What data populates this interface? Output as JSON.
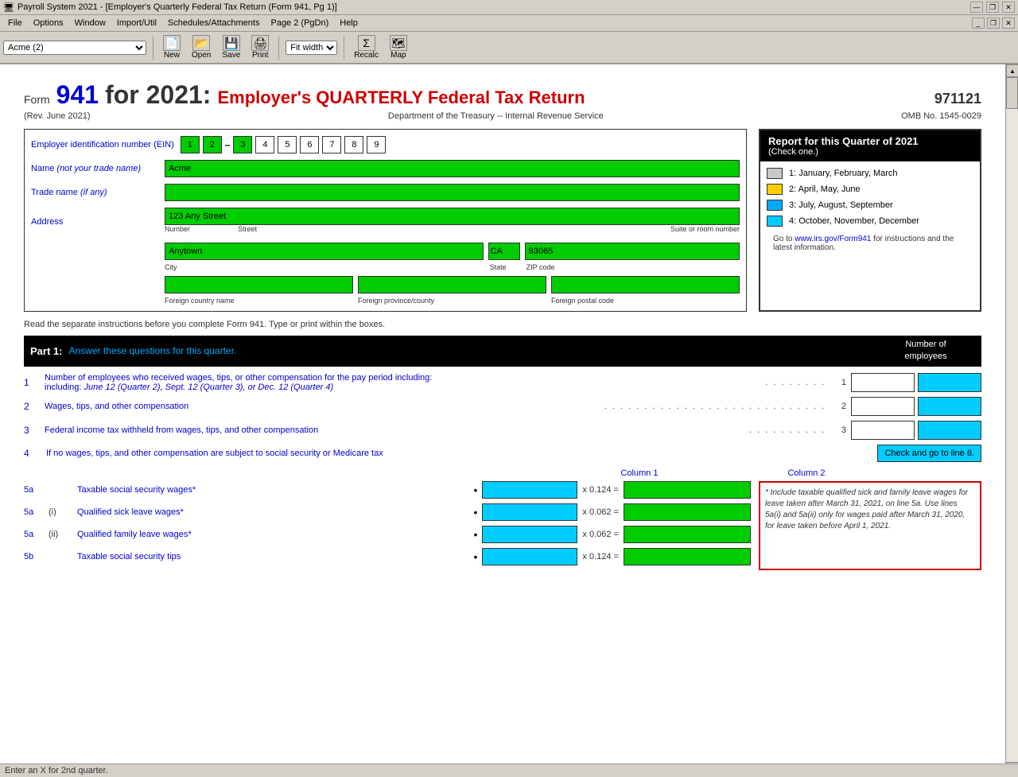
{
  "titlebar": {
    "title": "Payroll System 2021 - [Employer's Quarterly Federal Tax Return (Form 941, Pg 1)]",
    "min": "—",
    "restore": "❐",
    "close": "✕",
    "app_min": "_",
    "app_restore": "❐",
    "app_close": "✕"
  },
  "menubar": {
    "items": [
      "File",
      "Options",
      "Window",
      "Import/Util",
      "Schedules/Attachments",
      "Page 2 (PgDn)",
      "Help"
    ]
  },
  "toolbar": {
    "company_select": "Acme (2)",
    "new": "New",
    "open": "Open",
    "save": "Save",
    "print": "Print",
    "fit": "Fit width",
    "recalc": "Recalc",
    "map": "Map"
  },
  "form": {
    "number": "Form",
    "form_num": "941",
    "for_year": "for 2021:",
    "title": "Employer's QUARTERLY Federal Tax Return",
    "id_num": "971121",
    "rev": "(Rev. June 2021)",
    "dept": "Department of the Treasury -- Internal Revenue Service",
    "omb": "OMB No. 1545-0029",
    "ein_label": "Employer identification number (EIN)",
    "ein_digits": [
      "1",
      "2",
      "",
      "3",
      "4",
      "5",
      "6",
      "7",
      "8",
      "9"
    ],
    "name_label": "Name",
    "name_italic": "(not your trade name)",
    "name_value": "Acme",
    "trade_label": "Trade name",
    "trade_italic": "(if any)",
    "trade_value": "",
    "address_label": "Address",
    "address_value": "123 Any Street",
    "address_labels": [
      "Number",
      "Street",
      "Suite or room number"
    ],
    "city_value": "Anytown",
    "state_value": "CA",
    "zip_value": "93065",
    "city_label": "City",
    "state_label": "State",
    "zip_label": "ZIP code",
    "foreign_country_label": "Foreign country name",
    "foreign_province_label": "Foreign province/county",
    "foreign_postal_label": "Foreign postal code",
    "instructions": "Read the separate instructions before you complete Form 941.  Type or print within the boxes.",
    "quarter": {
      "header": "Report for this Quarter of 2021",
      "subtext": "(Check one.)",
      "q1_label": "1: January, February, March",
      "q2_label": "2: April, May, June",
      "q3_label": "3: July, August, September",
      "q4_label": "4: October, November, December",
      "q1_color": "#c8c8c8",
      "q2_color": "#ffcc00",
      "q3_color": "#00aaff",
      "q4_color": "#00ccff",
      "website_text": "Go to www.irs.gov/Form941 for instructions and the latest information.",
      "website_link": "www.irs.gov/Form941"
    },
    "part1": {
      "label": "Part 1:",
      "text": "Answer these questions for this quarter.",
      "num_employees_header": "Number of\nemployees",
      "q1_num": "1",
      "q1_text": "Number of employees who received wages, tips, or other compensation for the pay period including:",
      "q1_italic": "June 12 (Quarter 2), Sept. 12 (Quarter 3), or Dec. 12 (Quarter 4)",
      "q1_dots": ". . . . . . . .",
      "q1_line": "1",
      "q2_num": "2",
      "q2_text": "Wages, tips, and other compensation",
      "q2_dots": ". . . . . . . . . . . . . . . . . . . . . . . . . . . .",
      "q2_line": "2",
      "q3_num": "3",
      "q3_text": "Federal income tax withheld from wages, tips, and other compensation",
      "q3_dots": ". . . . . . . . . .",
      "q3_line": "3",
      "q4_num": "4",
      "q4_text": "If no wages, tips, and other compensation are subject to social security or Medicare tax",
      "check_go_label": "Check and go to line 6.",
      "cols_header1": "Column 1",
      "cols_header2": "Column 2",
      "p5a_num": "5a",
      "p5a_text": "Taxable social security wages*",
      "p5a_mult": "x 0.124 =",
      "p5ai_num": "5a",
      "p5ai_sub": "(i)",
      "p5ai_text": "Qualified sick leave wages*",
      "p5ai_mult": "x 0.062 =",
      "p5aii_num": "5a",
      "p5aii_sub": "(ii)",
      "p5aii_text": "Qualified family leave wages*",
      "p5aii_mult": "x 0.062 =",
      "p5b_num": "5b",
      "p5b_text": "Taxable social security tips",
      "p5b_mult": "x 0.124 =",
      "note_text": "* Include taxable qualified sick and family leave wages for leave taken after March 31, 2021, on line 5a. Use lines 5a(i) and 5a(ii) only for wages paid after March 31, 2020, for leave taken before April 1, 2021."
    }
  },
  "statusbar": {
    "text": "Enter an X for 2nd quarter."
  }
}
